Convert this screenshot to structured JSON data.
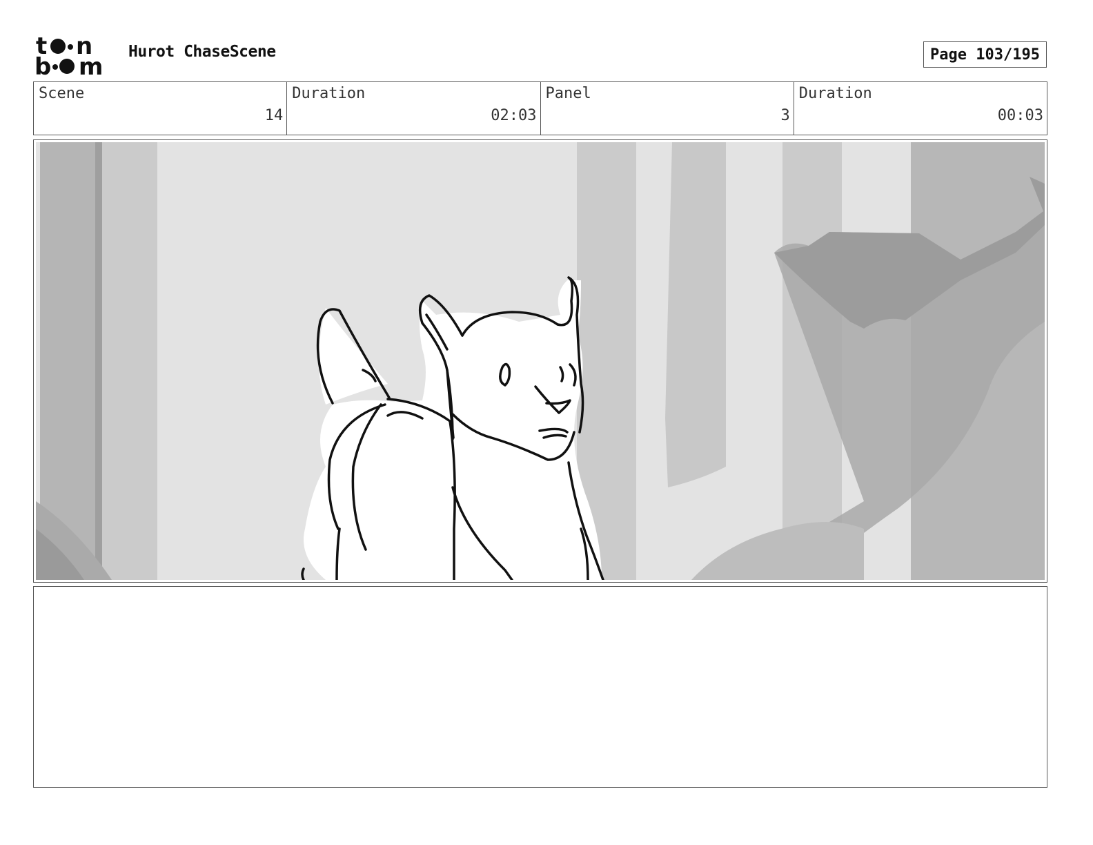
{
  "header": {
    "logo_text": "toon boom",
    "project_title": "Hurot ChaseScene",
    "page_label": "Page 103/195"
  },
  "info": {
    "scene_label": "Scene",
    "scene_value": "14",
    "scene_duration_label": "Duration",
    "scene_duration_value": "02:03",
    "panel_label": "Panel",
    "panel_value": "3",
    "panel_duration_label": "Duration",
    "panel_duration_value": "00:03"
  },
  "notes": {
    "text": ""
  }
}
